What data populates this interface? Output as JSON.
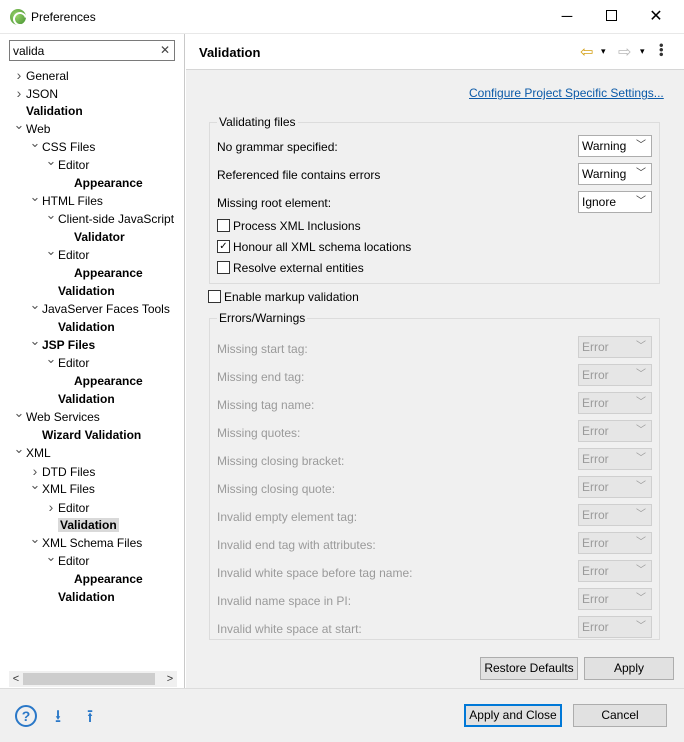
{
  "window": {
    "title": "Preferences"
  },
  "filter": {
    "value": "valida"
  },
  "tree": [
    {
      "label": "General",
      "depth": 0,
      "twisty": "collapsed",
      "bold": false
    },
    {
      "label": "JSON",
      "depth": 0,
      "twisty": "collapsed",
      "bold": false
    },
    {
      "label": "Validation",
      "depth": 0,
      "twisty": "none",
      "bold": true
    },
    {
      "label": "Web",
      "depth": 0,
      "twisty": "expanded",
      "bold": false
    },
    {
      "label": "CSS Files",
      "depth": 1,
      "twisty": "expanded",
      "bold": false
    },
    {
      "label": "Editor",
      "depth": 2,
      "twisty": "expanded",
      "bold": false
    },
    {
      "label": "Appearance",
      "depth": 3,
      "twisty": "none",
      "bold": true
    },
    {
      "label": "HTML Files",
      "depth": 1,
      "twisty": "expanded",
      "bold": false
    },
    {
      "label": "Client-side JavaScript",
      "depth": 2,
      "twisty": "expanded",
      "bold": false
    },
    {
      "label": "Validator",
      "depth": 3,
      "twisty": "none",
      "bold": true
    },
    {
      "label": "Editor",
      "depth": 2,
      "twisty": "expanded",
      "bold": false
    },
    {
      "label": "Appearance",
      "depth": 3,
      "twisty": "none",
      "bold": true
    },
    {
      "label": "Validation",
      "depth": 2,
      "twisty": "none",
      "bold": true
    },
    {
      "label": "JavaServer Faces Tools",
      "depth": 1,
      "twisty": "expanded",
      "bold": false
    },
    {
      "label": "Validation",
      "depth": 2,
      "twisty": "none",
      "bold": true
    },
    {
      "label": "JSP Files",
      "depth": 1,
      "twisty": "expanded",
      "bold": true
    },
    {
      "label": "Editor",
      "depth": 2,
      "twisty": "expanded",
      "bold": false
    },
    {
      "label": "Appearance",
      "depth": 3,
      "twisty": "none",
      "bold": true
    },
    {
      "label": "Validation",
      "depth": 2,
      "twisty": "none",
      "bold": true
    },
    {
      "label": "Web Services",
      "depth": 0,
      "twisty": "expanded",
      "bold": false
    },
    {
      "label": "Wizard Validation",
      "depth": 1,
      "twisty": "none",
      "bold": true
    },
    {
      "label": "XML",
      "depth": 0,
      "twisty": "expanded",
      "bold": false
    },
    {
      "label": "DTD Files",
      "depth": 1,
      "twisty": "collapsed",
      "bold": false
    },
    {
      "label": "XML Files",
      "depth": 1,
      "twisty": "expanded",
      "bold": false
    },
    {
      "label": "Editor",
      "depth": 2,
      "twisty": "collapsed",
      "bold": false
    },
    {
      "label": "Validation",
      "depth": 2,
      "twisty": "none",
      "bold": true,
      "selected": true
    },
    {
      "label": "XML Schema Files",
      "depth": 1,
      "twisty": "expanded",
      "bold": false
    },
    {
      "label": "Editor",
      "depth": 2,
      "twisty": "expanded",
      "bold": false
    },
    {
      "label": "Appearance",
      "depth": 3,
      "twisty": "none",
      "bold": true
    },
    {
      "label": "Validation",
      "depth": 2,
      "twisty": "none",
      "bold": true
    }
  ],
  "page": {
    "title": "Validation",
    "configure_link": "Configure Project Specific Settings...",
    "validating_files": {
      "label": "Validating files",
      "rows": [
        {
          "label": "No grammar specified:",
          "value": "Warning"
        },
        {
          "label": "Referenced file contains errors",
          "value": "Warning"
        },
        {
          "label": "Missing root element:",
          "value": "Ignore"
        }
      ],
      "checkboxes": [
        {
          "label": "Process XML Inclusions",
          "checked": false
        },
        {
          "label": "Honour all XML schema locations",
          "checked": true
        },
        {
          "label": "Resolve external entities",
          "checked": false
        }
      ]
    },
    "enable_markup": {
      "label": "Enable markup validation",
      "checked": false
    },
    "errors_warnings": {
      "label": "Errors/Warnings",
      "rows": [
        {
          "label": "Missing start tag:",
          "value": "Error"
        },
        {
          "label": "Missing end tag:",
          "value": "Error"
        },
        {
          "label": "Missing tag name:",
          "value": "Error"
        },
        {
          "label": "Missing quotes:",
          "value": "Error"
        },
        {
          "label": "Missing closing bracket:",
          "value": "Error"
        },
        {
          "label": "Missing closing quote:",
          "value": "Error"
        },
        {
          "label": "Invalid empty element tag:",
          "value": "Error"
        },
        {
          "label": "Invalid end tag with attributes:",
          "value": "Error"
        },
        {
          "label": "Invalid white space before tag name:",
          "value": "Error"
        },
        {
          "label": "Invalid name space in PI:",
          "value": "Error"
        },
        {
          "label": "Invalid white space at start:",
          "value": "Error"
        }
      ]
    },
    "restore_defaults": "Restore Defaults",
    "apply": "Apply"
  },
  "footer": {
    "apply_and_close": "Apply and Close",
    "cancel": "Cancel"
  },
  "glyphs": {
    "help": "?",
    "import": "⭳",
    "export": "⭱",
    "minimize": "─",
    "close": "✕",
    "back": "⇦",
    "forward": "⇨",
    "dropdown": "▾",
    "check": "✓"
  }
}
